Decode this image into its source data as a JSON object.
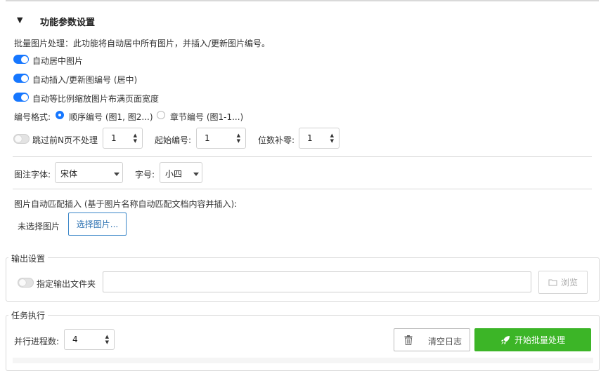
{
  "params": {
    "title": "功能参数设置",
    "collapse_glyph": "▼",
    "description": "批量图片处理：此功能将自动居中所有图片，并插入/更新图片编号。",
    "toggles": [
      {
        "label": "自动居中图片",
        "on": true
      },
      {
        "label": "自动插入/更新图编号 (居中)",
        "on": true
      },
      {
        "label": "自动等比例缩放图片布满页面宽度",
        "on": true
      }
    ],
    "numbering": {
      "label": "编号格式:",
      "options": [
        {
          "label": "顺序编号 (图1, 图2...)",
          "selected": true
        },
        {
          "label": "章节编号 (图1-1...)",
          "selected": false
        }
      ]
    },
    "skip": {
      "label": "跳过前N页不处理",
      "on": false,
      "value": "1"
    },
    "start_number": {
      "label": "起始编号:",
      "value": "1"
    },
    "padding": {
      "label": "位数补零:",
      "value": "1"
    },
    "caption_font": {
      "label": "图注字体:",
      "value": "宋体"
    },
    "font_size": {
      "label": "字号:",
      "value": "小四"
    },
    "auto_match": {
      "label": "图片自动匹配插入 (基于图片名称自动匹配文档内容并插入):",
      "status": "未选择图片",
      "button": "选择图片..."
    }
  },
  "output": {
    "group_title": "输出设置",
    "toggle_label": "指定输出文件夹",
    "toggle_on": false,
    "folder_value": "",
    "browse_label": "浏览",
    "browse_icon": "folder-icon"
  },
  "task": {
    "group_title": "任务执行",
    "process_label": "并行进程数:",
    "process_value": "4",
    "clear_label": "清空日志",
    "clear_icon": "trash-icon",
    "start_label": "开始批量处理",
    "start_icon": "rocket-icon"
  },
  "colors": {
    "accent": "#1677ff",
    "start_button": "#3cb527",
    "link_border": "#3a86c8"
  }
}
